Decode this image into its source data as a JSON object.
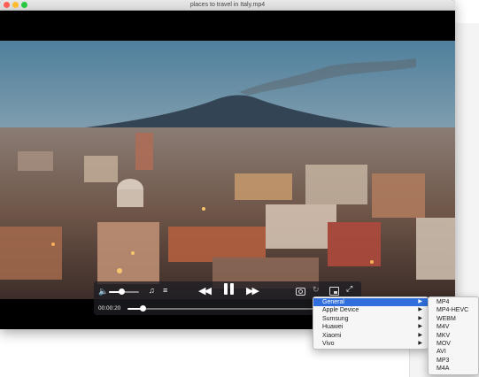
{
  "window": {
    "title": "places to travel in Italy.mp4"
  },
  "player": {
    "time": "00:00:20",
    "volume_percent": 40,
    "progress_percent": 8
  },
  "menu": {
    "items": [
      {
        "label": "General",
        "active": true
      },
      {
        "label": "Apple Device"
      },
      {
        "label": "Sumsung"
      },
      {
        "label": "Huawei"
      },
      {
        "label": "Xiaomi"
      },
      {
        "label": "Vivo"
      }
    ]
  },
  "submenu": {
    "items": [
      "MP4",
      "MP4-HEVC",
      "WEBM",
      "M4V",
      "MKV",
      "MOV",
      "AVI",
      "MP3",
      "M4A"
    ]
  },
  "colors": {
    "menu_highlight": "#2f6edc"
  }
}
